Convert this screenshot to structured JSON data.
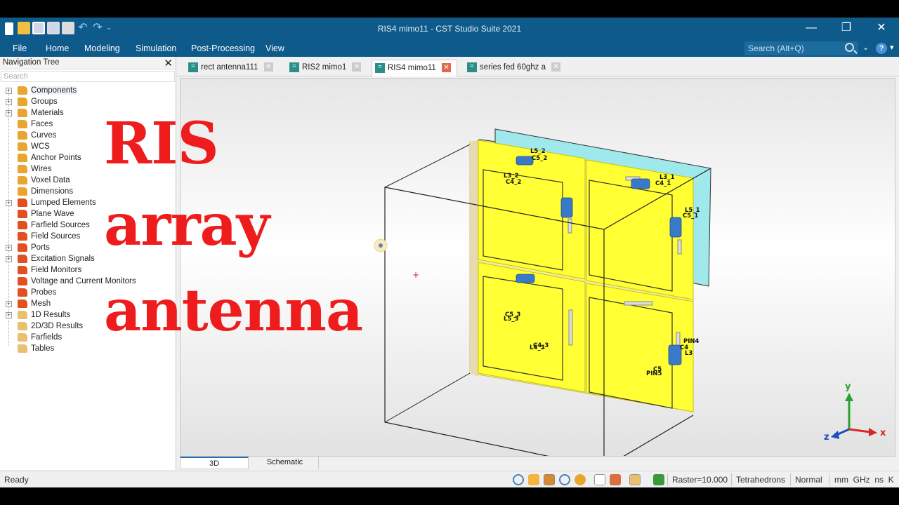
{
  "window": {
    "title": "RIS4 mimo11 - CST Studio Suite 2021",
    "controls": [
      "—",
      "❐",
      "✕"
    ]
  },
  "quick_access": {
    "icons": [
      "new-document-icon",
      "open-folder-icon",
      "save-icon",
      "save-all-icon",
      "print-icon",
      "undo-icon",
      "redo-icon",
      "customize-dropdown-icon"
    ],
    "undo_glyph": "↶",
    "redo_glyph": "↷",
    "drop_glyph": "⌄"
  },
  "menu": {
    "items": [
      "File",
      "Home",
      "Modeling",
      "Simulation",
      "Post-Processing",
      "View"
    ],
    "search_placeholder": "Search (Alt+Q)",
    "chevron": "⌄",
    "help": "?",
    "help_drop": "▾"
  },
  "nav_tree": {
    "title": "Navigation Tree",
    "close": "✕",
    "search_placeholder": "Search",
    "items": [
      {
        "label": "Components",
        "expand": true,
        "icon": "orange"
      },
      {
        "label": "Groups",
        "expand": true,
        "icon": "orange"
      },
      {
        "label": "Materials",
        "expand": true,
        "icon": "orange"
      },
      {
        "label": "Faces",
        "expand": false,
        "icon": "orange"
      },
      {
        "label": "Curves",
        "expand": false,
        "icon": "orange"
      },
      {
        "label": "WCS",
        "expand": false,
        "icon": "orange"
      },
      {
        "label": "Anchor Points",
        "expand": false,
        "icon": "orange"
      },
      {
        "label": "Wires",
        "expand": false,
        "icon": "orange"
      },
      {
        "label": "Voxel Data",
        "expand": false,
        "icon": "orange"
      },
      {
        "label": "Dimensions",
        "expand": false,
        "icon": "orange"
      },
      {
        "label": "Lumped Elements",
        "expand": true,
        "icon": "red"
      },
      {
        "label": "Plane Wave",
        "expand": false,
        "icon": "red"
      },
      {
        "label": "Farfield Sources",
        "expand": false,
        "icon": "red"
      },
      {
        "label": "Field Sources",
        "expand": false,
        "icon": "red"
      },
      {
        "label": "Ports",
        "expand": true,
        "icon": "red"
      },
      {
        "label": "Excitation Signals",
        "expand": true,
        "icon": "red"
      },
      {
        "label": "Field Monitors",
        "expand": false,
        "icon": "red"
      },
      {
        "label": "Voltage and Current Monitors",
        "expand": false,
        "icon": "red"
      },
      {
        "label": "Probes",
        "expand": false,
        "icon": "red"
      },
      {
        "label": "Mesh",
        "expand": true,
        "icon": "red"
      },
      {
        "label": "1D Results",
        "expand": true,
        "icon": "plain"
      },
      {
        "label": "2D/3D Results",
        "expand": false,
        "icon": "plain"
      },
      {
        "label": "Farfields",
        "expand": false,
        "icon": "plain"
      },
      {
        "label": "Tables",
        "expand": false,
        "icon": "plain"
      }
    ]
  },
  "doc_tabs": [
    {
      "label": "rect antenna111",
      "active": false
    },
    {
      "label": "RIS2 mimo1",
      "active": false
    },
    {
      "label": "RIS4 mimo11",
      "active": true
    },
    {
      "label": "series fed 60ghz a",
      "active": false
    }
  ],
  "overlay": {
    "line1": "RIS",
    "line2": "array",
    "line3": "antenna",
    "color": "#ee1c1c"
  },
  "model_labels": [
    "L5_2",
    "C5_2",
    "L3_2",
    "C4_2",
    "L3_1",
    "C4_1",
    "L5_1",
    "C5_1",
    "C5_3",
    "L5_3",
    "L4_3",
    "C4_3",
    "PIN4",
    "C4",
    "L3",
    "PIN5",
    "C5"
  ],
  "axes": {
    "x": "x",
    "y": "y",
    "z": "z"
  },
  "view_tabs": [
    {
      "label": "3D",
      "active": true
    },
    {
      "label": "Schematic",
      "active": false
    }
  ],
  "status": {
    "text": "Ready",
    "raster": "Raster=10.000",
    "mesh": "Tetrahedrons",
    "mode": "Normal",
    "units": "mm  GHz  ns  K"
  },
  "colors": {
    "titlebar": "#0e5a8a",
    "patch": "#ffff33",
    "substrate": "#f5f0a8",
    "ground": "#9fe8ec",
    "component": "#3a78c8"
  }
}
